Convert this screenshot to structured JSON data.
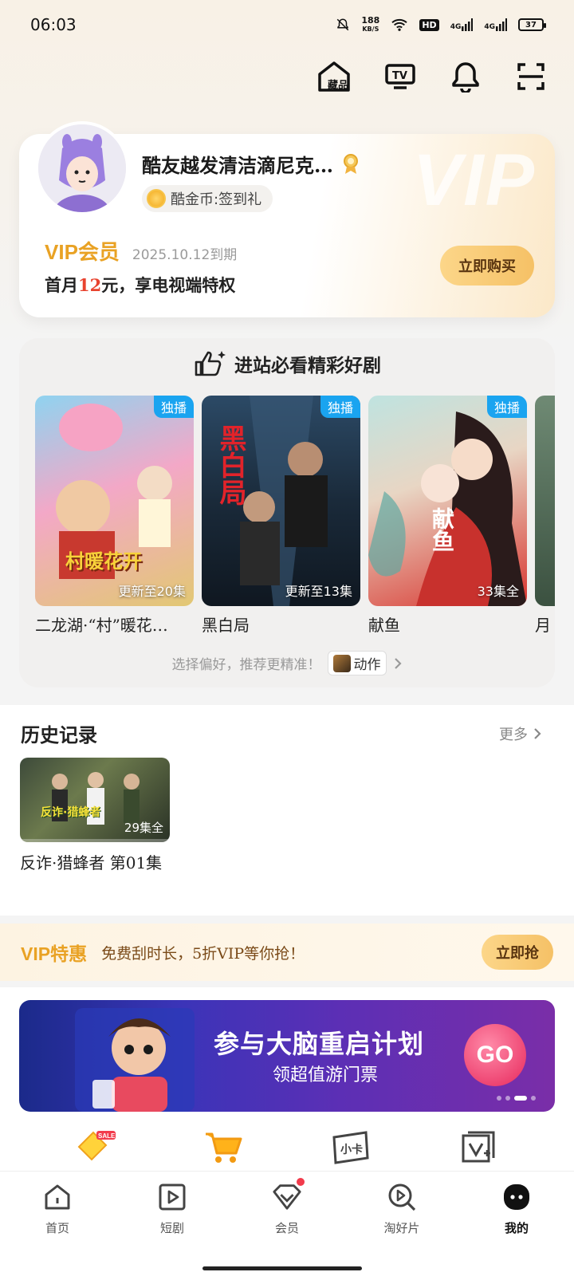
{
  "status_bar": {
    "time": "06:03",
    "net_speed_value": "188",
    "net_speed_unit": "KB/S",
    "hd_label": "HD",
    "signal_1": "4G",
    "signal_2": "4G",
    "battery": "37"
  },
  "top_actions": [
    {
      "name": "collection-icon",
      "label": "藏品"
    },
    {
      "name": "tv-icon",
      "label": "TV"
    },
    {
      "name": "bell-icon"
    },
    {
      "name": "scan-icon"
    }
  ],
  "profile": {
    "username": "酷友越发清洁滴尼克…",
    "coin_label": "酷金币:签到礼",
    "vip_label": "VIP会员",
    "vip_expire": "2025.10.12到期",
    "vip_desc_prefix": "首月",
    "vip_desc_price": "12",
    "vip_desc_suffix": "元，享电视端特权",
    "buy_button": "立即购买",
    "watermark": "VIP"
  },
  "recommend": {
    "title": "进站必看精彩好剧",
    "items": [
      {
        "title": "二龙湖·“村”暖花…",
        "tag": "独播",
        "episodes": "更新至20集",
        "poster_text": "村暖花开",
        "colors": [
          "#8fd3f0",
          "#f3a8c7",
          "#e2c873"
        ]
      },
      {
        "title": "黑白局",
        "tag": "独播",
        "episodes": "更新至13集",
        "poster_text": "黑白局",
        "colors": [
          "#1a2a3a",
          "#3a5a78",
          "#0f1720"
        ]
      },
      {
        "title": "献鱼",
        "tag": "独播",
        "episodes": "33集全",
        "poster_text": "献鱼",
        "colors": [
          "#bfe3e0",
          "#e07a5f",
          "#d8342e"
        ]
      }
    ],
    "partial_title": "月",
    "preference_text": "选择偏好，推荐更精准！",
    "preference_chip": "动作"
  },
  "history": {
    "title": "历史记录",
    "more": "更多",
    "items": [
      {
        "name": "反诈·猎蜂者 第01集",
        "episodes": "29集全",
        "thumb_text": "反诈·猎蜂者"
      }
    ]
  },
  "vip_promo": {
    "label": "VIP特惠",
    "text": "免费刮时长，5折VIP等你抢！",
    "button": "立即抢"
  },
  "banner": {
    "title": "参与大脑重启计划",
    "subtitle": "领超值游门票",
    "go": "GO"
  },
  "shortcuts": [
    {
      "name": "sale-icon",
      "label": "SALE"
    },
    {
      "name": "shopping-cart-icon"
    },
    {
      "name": "card-icon",
      "label": "小卡"
    },
    {
      "name": "vip-video-icon"
    }
  ],
  "nav": [
    {
      "label": "首页",
      "icon": "home-icon",
      "active": false
    },
    {
      "label": "短剧",
      "icon": "play-icon",
      "active": false
    },
    {
      "label": "会员",
      "icon": "vip-diamond-icon",
      "active": false,
      "dot": true
    },
    {
      "label": "淘好片",
      "icon": "search-play-icon",
      "active": false
    },
    {
      "label": "我的",
      "icon": "my-icon",
      "active": true
    }
  ]
}
